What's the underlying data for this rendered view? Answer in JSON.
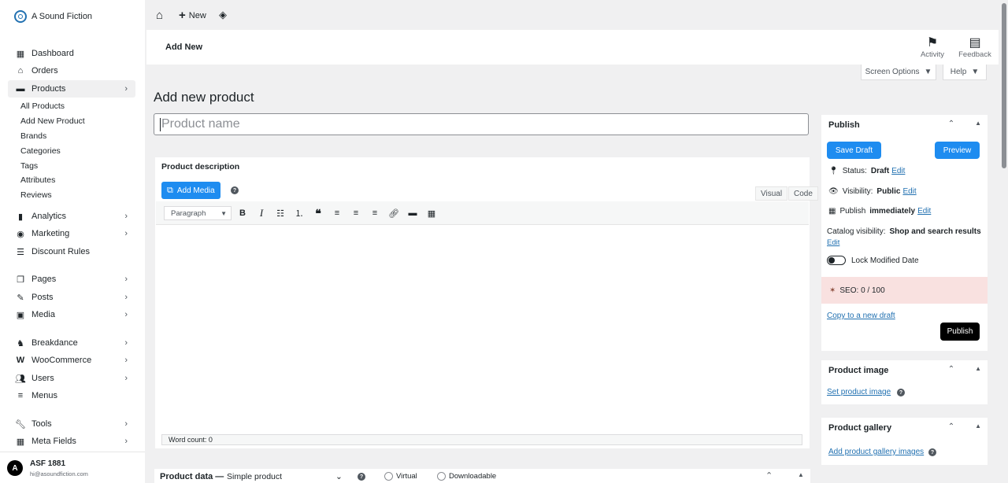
{
  "brand": {
    "name": "A Sound Fiction"
  },
  "sidebar": {
    "items": [
      {
        "label": "Dashboard",
        "icon": "dashboard-icon"
      },
      {
        "label": "Orders",
        "icon": "inbox-icon"
      },
      {
        "label": "Products",
        "icon": "archive-icon"
      },
      {
        "label": "Analytics",
        "icon": "bar-chart-icon"
      },
      {
        "label": "Marketing",
        "icon": "megaphone-icon"
      },
      {
        "label": "Discount Rules",
        "icon": "list-icon"
      },
      {
        "label": "Pages",
        "icon": "pages-icon"
      },
      {
        "label": "Posts",
        "icon": "edit-icon"
      },
      {
        "label": "Media",
        "icon": "media-icon"
      },
      {
        "label": "Breakdance",
        "icon": "breakdance-icon"
      },
      {
        "label": "WooCommerce",
        "icon": "woocommerce-icon"
      },
      {
        "label": "Users",
        "icon": "users-icon"
      },
      {
        "label": "Menus",
        "icon": "menu-icon"
      },
      {
        "label": "Tools",
        "icon": "wrench-icon"
      },
      {
        "label": "Meta Fields",
        "icon": "table-icon"
      }
    ],
    "products_sub": [
      "All Products",
      "Add New Product",
      "Brands",
      "Categories",
      "Tags",
      "Attributes",
      "Reviews"
    ]
  },
  "user": {
    "name": "ASF 1881",
    "email": "hi@asoundfiction.com",
    "initial": "A"
  },
  "topbar": {
    "new_label": "New"
  },
  "header": {
    "title": "Add New",
    "activity": "Activity",
    "feedback": "Feedback"
  },
  "screen_options": "Screen Options",
  "help": "Help",
  "page": {
    "heading": "Add new product",
    "name_placeholder": "Product name"
  },
  "editor": {
    "title": "Product description",
    "add_media": "Add Media",
    "tab_visual": "Visual",
    "tab_code": "Code",
    "format": "Paragraph",
    "word_count": "Word count: 0"
  },
  "product_data": {
    "label": "Product data —",
    "type": "Simple product",
    "virtual": "Virtual",
    "downloadable": "Downloadable"
  },
  "publish": {
    "title": "Publish",
    "save_draft": "Save Draft",
    "preview": "Preview",
    "status_label": "Status:",
    "status_value": "Draft",
    "visibility_label": "Visibility:",
    "visibility_value": "Public",
    "publish_label": "Publish",
    "publish_value": "immediately",
    "edit": "Edit",
    "catalog_label": "Catalog visibility:",
    "catalog_value": "Shop and search results",
    "lock_modified": "Lock Modified Date",
    "seo": "SEO: 0 / 100",
    "copy_draft": "Copy to a new draft",
    "publish_btn": "Publish"
  },
  "product_image": {
    "title": "Product image",
    "link": "Set product image"
  },
  "product_gallery": {
    "title": "Product gallery",
    "link": "Add product gallery images"
  },
  "colors": {
    "accent": "#1e8cf0",
    "link": "#2271b1",
    "seo_bg": "#f9e1e0"
  }
}
